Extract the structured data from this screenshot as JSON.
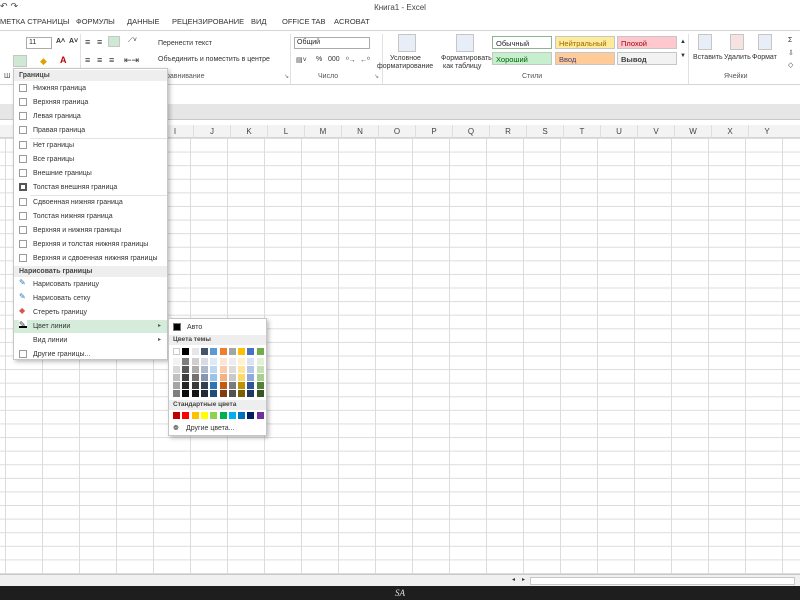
{
  "window": {
    "title": "Книга1 - Excel",
    "qat": [
      "↶",
      "↷"
    ]
  },
  "tabs": [
    "МЕТКА СТРАНИЦЫ",
    "ФОРМУЛЫ",
    "ДАННЫЕ",
    "РЕЦЕНЗИРОВАНИЕ",
    "ВИД",
    "OFFICE TAB",
    "ACROBAT"
  ],
  "ribbon": {
    "font_size": "11",
    "number_format": "Общий",
    "wrap_text": "Перенести текст",
    "merge_center": "Объединить и поместить в центре",
    "percent": "%",
    "thousands": "000",
    "cond_format": [
      "Условное",
      "форматирование"
    ],
    "format_table": [
      "Форматировать",
      "как таблицу"
    ],
    "styles": {
      "normal": "Обычный",
      "neutral": "Нейтральный",
      "bad": "Плохой",
      "good": "Хороший",
      "input": "Ввод",
      "output": "Вывод"
    },
    "cells": {
      "insert": "Вставить",
      "delete": "Удалить",
      "format": "Формат"
    },
    "group_labels": {
      "font": "Ш",
      "alignment": "равнивание",
      "number": "Число",
      "styles": "Стили",
      "cells": "Ячейки"
    },
    "colors": {
      "normal_bg": "#ffffff",
      "neutral_bg": "#ffeb9c",
      "neutral_fg": "#9c6500",
      "bad_bg": "#ffc7ce",
      "bad_fg": "#9c0006",
      "good_bg": "#c6efce",
      "good_fg": "#006100",
      "input_bg": "#ffcc99",
      "input_fg": "#3f3f76",
      "output_bg": "#f2f2f2",
      "output_fg": "#3f3f3f"
    }
  },
  "columns": [
    "I",
    "J",
    "K",
    "L",
    "M",
    "N",
    "O",
    "P",
    "Q",
    "R",
    "S",
    "T",
    "U",
    "V",
    "W",
    "X",
    "Y"
  ],
  "borders_menu": {
    "header1": "Границы",
    "items1": [
      "Нижняя граница",
      "Верхняя граница",
      "Левая граница",
      "Правая граница"
    ],
    "items2": [
      "Нет границы",
      "Все границы",
      "Внешние границы",
      "Толстая внешняя граница"
    ],
    "items3": [
      "Сдвоенная нижняя граница",
      "Толстая нижняя граница",
      "Верхняя и нижняя границы",
      "Верхняя и толстая нижняя границы",
      "Верхняя и сдвоенная нижняя границы"
    ],
    "header2": "Нарисовать границы",
    "items4": [
      "Нарисовать границу",
      "Нарисовать сетку",
      "Стереть границу"
    ],
    "line_color": "Цвет линии",
    "line_style": "Вид линии",
    "more_borders": "Другие границы...",
    "highlight_color": "#d5ecdb"
  },
  "color_submenu": {
    "auto": "Авто",
    "theme_header": "Цвета темы",
    "standard_header": "Стандартные цвета",
    "more_colors": "Другие цвета...",
    "theme_top": [
      "#ffffff",
      "#000000",
      "#e7e6e6",
      "#44546a",
      "#5b9bd5",
      "#ed7d31",
      "#a5a5a5",
      "#ffc000",
      "#4472c4",
      "#70ad47"
    ],
    "theme_shades": [
      [
        "#f2f2f2",
        "#7f7f7f",
        "#d0cece",
        "#d6dce4",
        "#deebf6",
        "#fbe5d5",
        "#ededed",
        "#fff2cc",
        "#dae3f3",
        "#e2efd9"
      ],
      [
        "#d8d8d8",
        "#595959",
        "#aeabab",
        "#adb9ca",
        "#bdd7ee",
        "#f7cbac",
        "#dbdbdb",
        "#fee599",
        "#b4c6e7",
        "#c5e0b3"
      ],
      [
        "#bfbfbf",
        "#3f3f3f",
        "#757070",
        "#8496b0",
        "#9cc3e5",
        "#f4b183",
        "#c9c9c9",
        "#ffd965",
        "#8eaadb",
        "#a8d08d"
      ],
      [
        "#a5a5a5",
        "#262626",
        "#3a3838",
        "#323f4f",
        "#2e75b5",
        "#c55a11",
        "#7b7b7b",
        "#bf9000",
        "#2f5496",
        "#538135"
      ],
      [
        "#7f7f7f",
        "#0c0c0c",
        "#171616",
        "#222a35",
        "#1e4e79",
        "#833c0b",
        "#525252",
        "#7f6000",
        "#1f3864",
        "#375623"
      ]
    ],
    "standard": [
      "#c00000",
      "#ff0000",
      "#ffc000",
      "#ffff00",
      "#92d050",
      "#00b050",
      "#00b0f0",
      "#0070c0",
      "#002060",
      "#7030a0"
    ]
  },
  "status_text": "SA"
}
